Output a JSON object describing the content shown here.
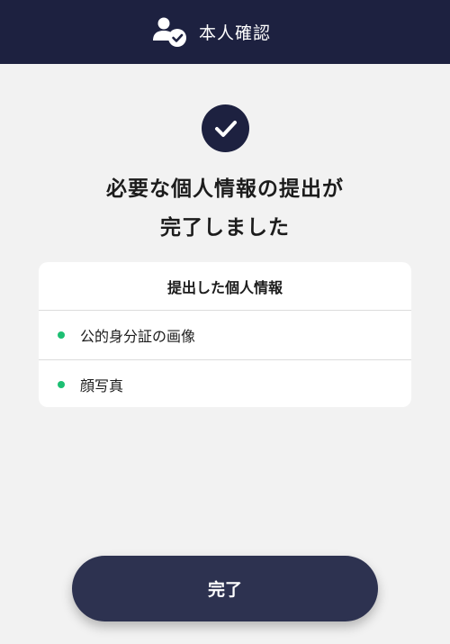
{
  "header": {
    "title": "本人確認",
    "icon": "user-check-icon"
  },
  "status": {
    "icon": "check-icon",
    "title_line1": "必要な個人情報の提出が",
    "title_line2": "完了しました"
  },
  "submitted_card": {
    "heading": "提出した個人情報",
    "items": [
      {
        "label": "公的身分証の画像"
      },
      {
        "label": "顔写真"
      }
    ],
    "bullet_color": "#1dbf73"
  },
  "footer": {
    "done_label": "完了"
  },
  "colors": {
    "header_bg": "#1d2140",
    "button_bg": "#2d3250",
    "page_bg": "#f2f2f2"
  }
}
